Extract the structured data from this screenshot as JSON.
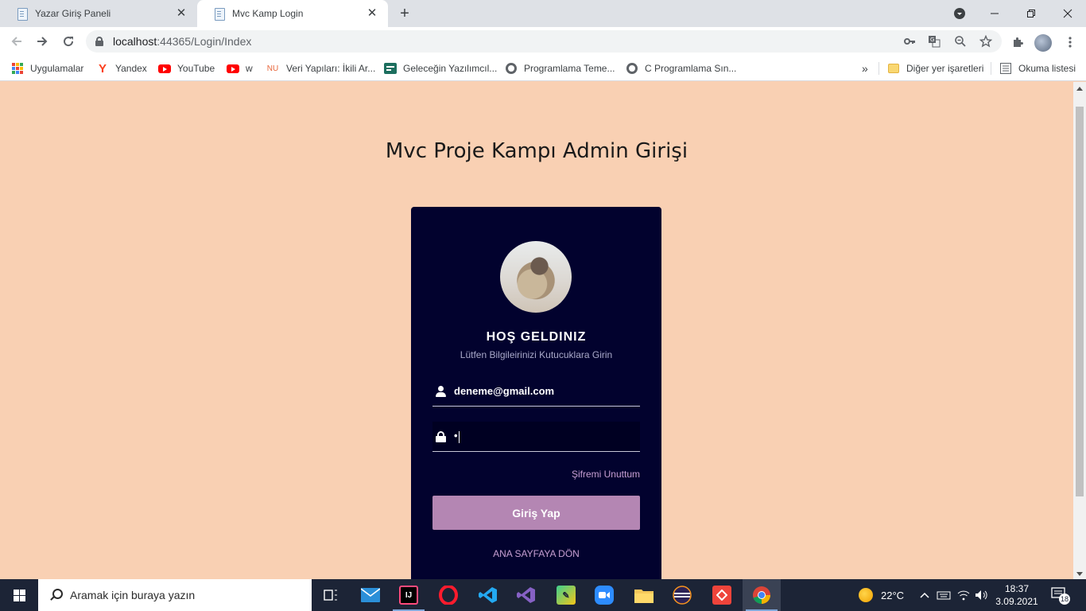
{
  "browser": {
    "tabs": [
      {
        "title": "Yazar Giriş Paneli",
        "active": false
      },
      {
        "title": "Mvc Kamp Login",
        "active": true
      }
    ],
    "url_host": "localhost",
    "url_port": ":44365",
    "url_path": "/Login/Index",
    "bookmarks": [
      {
        "label": "Uygulamalar",
        "icon": "apps-grid-icon"
      },
      {
        "label": "Yandex",
        "icon": "yandex-icon"
      },
      {
        "label": "YouTube",
        "icon": "youtube-icon"
      },
      {
        "label": "w",
        "icon": "youtube-icon"
      },
      {
        "label": "Veri Yapıları: İkili Ar...",
        "icon": "nu-icon",
        "icon_text": "NU"
      },
      {
        "label": "Geleceğin Yazılımcıl...",
        "icon": "site-icon"
      },
      {
        "label": "Programlama Teme...",
        "icon": "globe-icon"
      },
      {
        "label": "C Programlama Sın...",
        "icon": "globe-icon"
      }
    ],
    "overflow_label": "»",
    "other_bookmarks": "Diğer yer işaretleri",
    "reading_list": "Okuma listesi"
  },
  "page": {
    "heading": "Mvc Proje Kampı Admin Girişi",
    "card": {
      "welcome": "HOŞ GELDINIZ",
      "subtitle": "Lütfen Bilgileirinizi Kutucuklara Girin",
      "email_value": "deneme@gmail.com",
      "password_mask": "•",
      "forgot_link": "Şifremi Unuttum",
      "login_button": "Giriş Yap",
      "home_link": "ANA SAYFAYA DÖN"
    }
  },
  "taskbar": {
    "search_placeholder": "Aramak için buraya yazın",
    "weather_temp": "22°C",
    "time": "18:37",
    "date": "3.09.2021",
    "notification_count": "18"
  },
  "colors": {
    "page_bg": "#f9d0b3",
    "card_bg": "#02022e",
    "button_bg": "#b486b3",
    "link_color": "#c79fd1"
  }
}
